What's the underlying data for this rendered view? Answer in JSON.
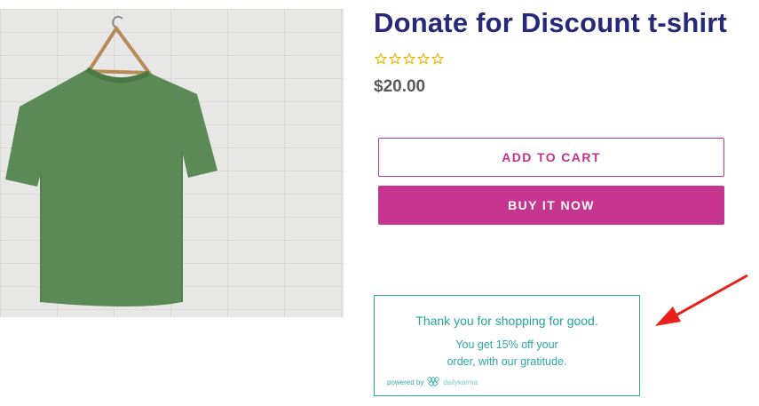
{
  "product": {
    "title": "Donate for Discount t-shirt",
    "price": "$20.00",
    "rating": {
      "filled": 0,
      "max": 5
    },
    "image_icon": "green-t-shirt-on-hanger"
  },
  "buttons": {
    "add_to_cart": "ADD TO CART",
    "buy_now": "BUY IT NOW"
  },
  "karma": {
    "title": "Thank you for shopping for good.",
    "line1": "You get 15% off your",
    "line2": "order, with our gratitude.",
    "powered_by": "powered by",
    "brand": "dailykarma"
  },
  "colors": {
    "title": "#27287a",
    "accent": "#c6358f",
    "teal": "#2aa7a5",
    "star": "#e6b800",
    "arrow": "#e8211c"
  }
}
